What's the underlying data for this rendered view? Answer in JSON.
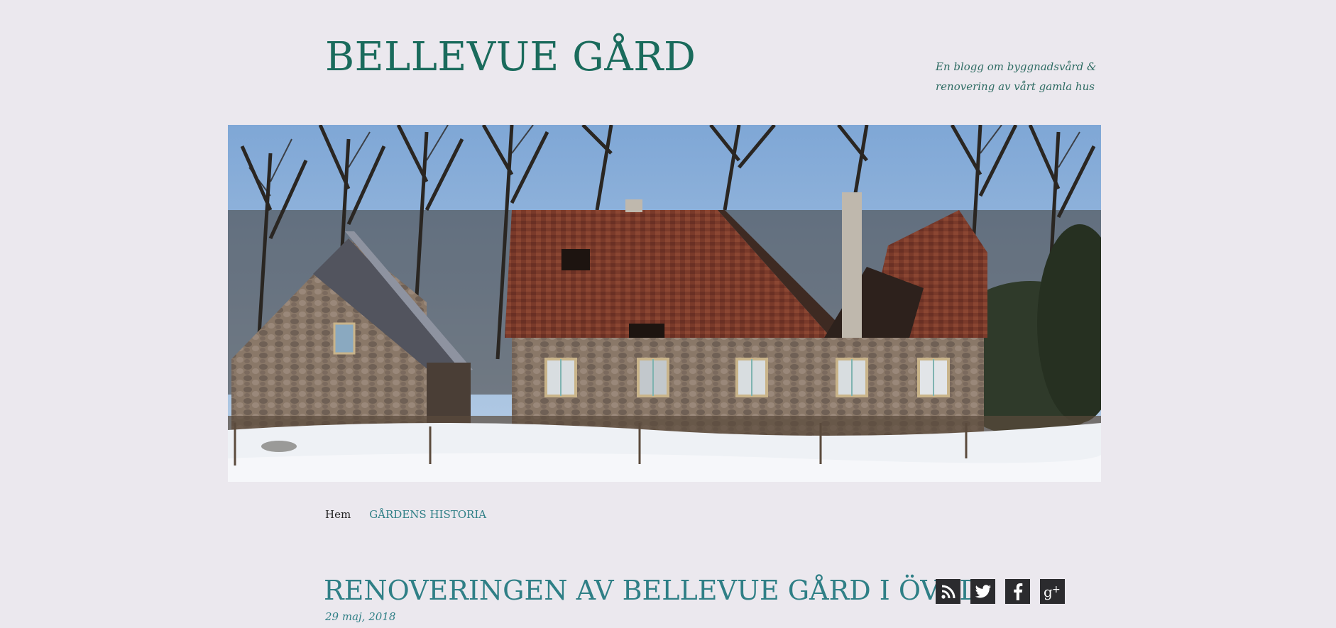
{
  "header": {
    "site_title": "BELLEVUE GÅRD",
    "tagline_line1": "En blogg om byggnadsvård &",
    "tagline_line2": "renovering av vårt gamla hus"
  },
  "hero": {
    "image": "header-photo-old-farmhouse-in-snow"
  },
  "nav": {
    "items": [
      {
        "label": "Hem",
        "current": true
      },
      {
        "label": "GÅRDENS HISTORIA",
        "current": false
      }
    ]
  },
  "post": {
    "title": "RENOVERINGEN AV BELLEVUE GÅRD I ÖVED",
    "date": "29 maj, 2018"
  },
  "social": {
    "icons": [
      "rss-icon",
      "twitter-icon",
      "facebook-icon",
      "google-plus-icon"
    ]
  },
  "colors": {
    "background": "#ebe8ee",
    "title": "#1a6b5c",
    "accent": "#2f7f86",
    "social_bg": "#2b2b2e"
  }
}
